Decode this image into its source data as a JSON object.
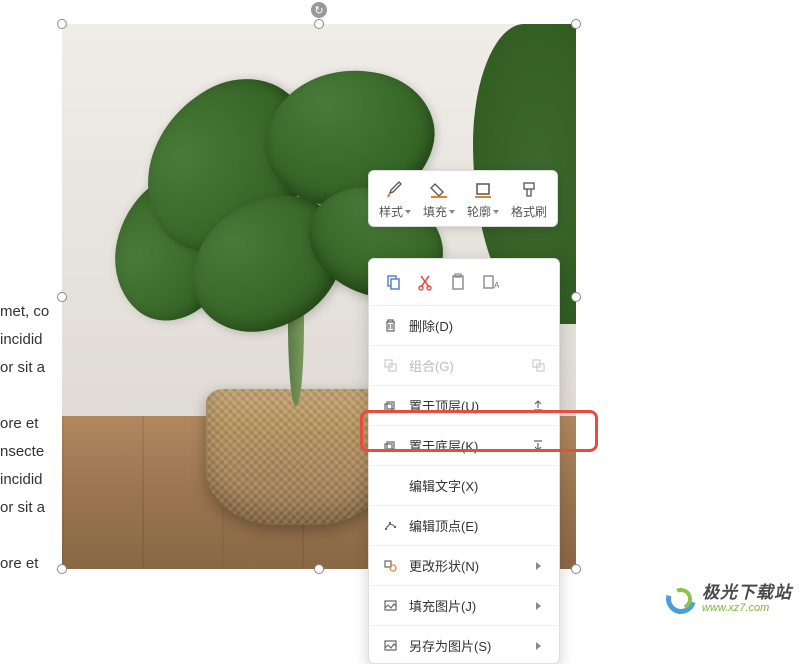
{
  "document": {
    "line1": "met, co",
    "line2": " incidid",
    "line3": "or sit a",
    "line4": "ore et",
    "line5": "nsecte",
    "line6": " incidid",
    "line7": "or sit a",
    "line8": "ore et"
  },
  "toolbar": {
    "style": "样式",
    "fill": "填充",
    "outline": "轮廓",
    "format_painter": "格式刷"
  },
  "context_menu": {
    "delete": "删除(D)",
    "group": "组合(G)",
    "bring_front": "置于顶层(U)",
    "send_back": "置于底层(K)",
    "edit_text": "编辑文字(X)",
    "edit_points": "编辑顶点(E)",
    "change_shape": "更改形状(N)",
    "fill_picture": "填充图片(J)",
    "save_as_picture": "另存为图片(S)"
  },
  "watermark": {
    "title": "极光下载站",
    "url": "www.xz7.com"
  }
}
